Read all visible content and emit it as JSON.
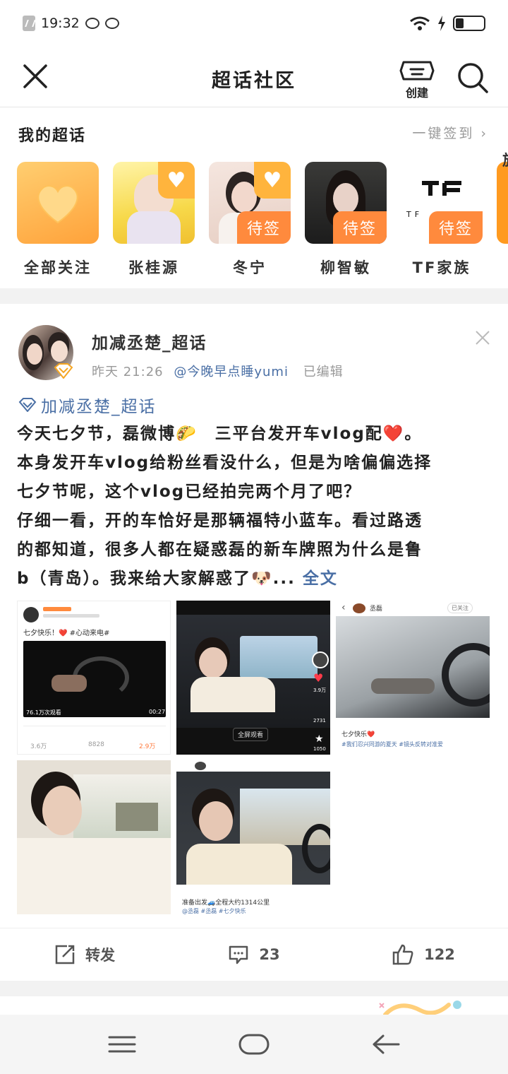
{
  "status_bar": {
    "time": "19:32"
  },
  "nav": {
    "title": "超话社区",
    "create_label": "创建"
  },
  "my_topics": {
    "title": "我的超话",
    "checkin_label": "一键签到 ›",
    "tiles": [
      {
        "label": "全部关注",
        "badge": ""
      },
      {
        "label": "张桂源",
        "badge": ""
      },
      {
        "label": "冬宁",
        "badge": "待签"
      },
      {
        "label": "柳智敏",
        "badge": "待签"
      },
      {
        "label": "TF家族",
        "badge": "待签",
        "logo_text": "TF"
      }
    ],
    "partial_label": "旅"
  },
  "post": {
    "author": "加减丞楚_超话",
    "time": "昨天 21:26",
    "mention": "@今晚早点睡yumi",
    "edited": "已编辑",
    "topic": "加减丞楚_超话",
    "body_lines": [
      "今天七夕节，磊微博🌮　三平台发开车vlog配❤️。",
      "本身发开车vlog给粉丝看没什么，但是为啥偏偏选择",
      "七夕节呢，这个vlog已经拍完两个月了吧？",
      "仔细一看，开的车恰好是那辆福特小蓝车。看过路透",
      "的都知道，很多人都在疑惑磊的新车牌照为什么是鲁",
      "b（青岛）。我来给大家解惑了🐶..."
    ],
    "fulltext": "全文",
    "images": {
      "img1": {
        "caption": "七夕快乐！❤️ #心动来电#",
        "views": "76.1万次观看",
        "duration": "00:27",
        "reposts": "3.6万",
        "comments": "8828",
        "likes": "2.9万"
      },
      "img2": {
        "likes": "3.9万",
        "comments": "2731",
        "favs": "1050",
        "button": "全屏观看"
      },
      "img3": {
        "name": "丞磊",
        "follow": "已关注",
        "caption": "七夕快乐❤️",
        "tags": "#我们忍兴同游的夏天 #镜头反转对准爱"
      },
      "img4": {},
      "img5": {
        "caption": "准备出发🚙全程大约1314公里",
        "tags": "@丞磊 #丞磊 #七夕快乐"
      }
    },
    "actions": {
      "repost_label": "转发",
      "comment_count": "23",
      "like_count": "122"
    }
  }
}
